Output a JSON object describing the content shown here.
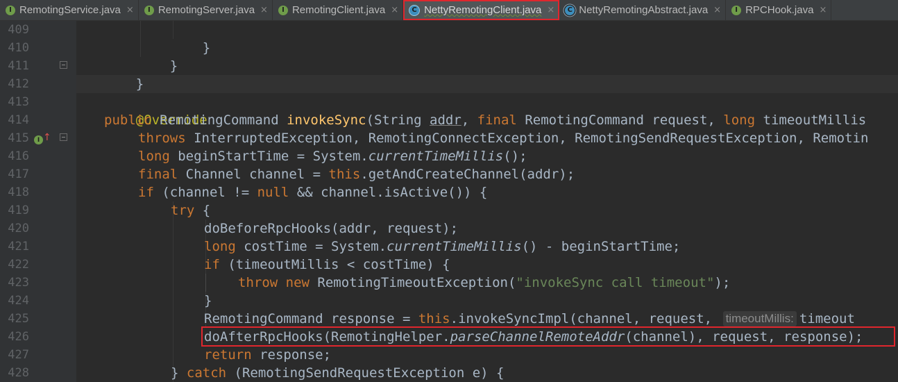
{
  "tabs": [
    {
      "label": "RemotingService.java",
      "icon": "I",
      "kind": "interface",
      "active": false
    },
    {
      "label": "RemotingServer.java",
      "icon": "I",
      "kind": "interface",
      "active": false
    },
    {
      "label": "RemotingClient.java",
      "icon": "I",
      "kind": "interface",
      "active": false
    },
    {
      "label": "NettyRemotingClient.java",
      "icon": "C",
      "kind": "class",
      "active": true
    },
    {
      "label": "NettyRemotingAbstract.java",
      "icon": "C",
      "kind": "abstract-class",
      "active": false
    },
    {
      "label": "RPCHook.java",
      "icon": "I",
      "kind": "interface",
      "active": false
    }
  ],
  "tab_close_glyph": "×",
  "gutter": {
    "line_numbers": [
      "409",
      "410",
      "411",
      "412",
      "413",
      "414",
      "415",
      "416",
      "417",
      "418",
      "419",
      "420",
      "421",
      "422",
      "423",
      "424",
      "425",
      "426",
      "427",
      "428"
    ],
    "impl_marker_icon": "implements-method-icon",
    "impl_marker_letter": "I",
    "override_arrow": "↑"
  },
  "colors": {
    "background": "#2b2b2b",
    "keyword": "#cc7832",
    "annotation": "#bbb529",
    "method_decl": "#ffc66d",
    "string": "#6a8759",
    "default_text": "#a9b7c6",
    "highlight_box": "#e0262d"
  },
  "code": {
    "l409": {
      "brace": "}"
    },
    "l410": {
      "brace": "}"
    },
    "l411": {
      "brace": "}"
    },
    "l413": {
      "annotation": "@Override"
    },
    "l414": {
      "kw_public": "public",
      "type": " RemotingCommand ",
      "method": "invokeSync",
      "params_a": "(String ",
      "addr": "addr",
      "params_b": ", ",
      "kw_final": "final",
      "params_c": " RemotingCommand request, ",
      "kw_long": "long",
      "params_d": " timeoutMillis"
    },
    "l415": {
      "kw_throws": "throws",
      "rest": " InterruptedException, RemotingConnectException, RemotingSendRequestException, Remotin"
    },
    "l416": {
      "kw_long": "long",
      "a": " beginStartTime = System.",
      "call": "currentTimeMillis",
      "b": "();"
    },
    "l417": {
      "kw_final": "final",
      "a": " Channel channel = ",
      "kw_this": "this",
      "b": ".getAndCreateChannel(addr);"
    },
    "l418": {
      "kw_if": "if",
      "a": " (channel != ",
      "kw_null": "null",
      "b": " && channel.isActive()) {"
    },
    "l419": {
      "kw_try": "try",
      "b": " {"
    },
    "l420": {
      "text": "doBeforeRpcHooks(addr, request);"
    },
    "l421": {
      "kw_long": "long",
      "a": " costTime = System.",
      "call": "currentTimeMillis",
      "b": "() - beginStartTime;"
    },
    "l422": {
      "kw_if": "if",
      "b": " (timeoutMillis < costTime) {"
    },
    "l423": {
      "kw_throw": "throw",
      "kw_new": "new",
      "a": " RemotingTimeoutException(",
      "str": "\"invokeSync call timeout\"",
      "b": ");"
    },
    "l424": {
      "brace": "}"
    },
    "l425": {
      "a": "RemotingCommand response = ",
      "kw_this": "this",
      "b": ".invokeSyncImpl(channel, request, ",
      "hint": "timeoutMillis:",
      "c": "timeout"
    },
    "l426": {
      "a": "doAfterRpcHooks(RemotingHelper.",
      "call": "parseChannelRemoteAddr",
      "b": "(channel), request, response);"
    },
    "l427": {
      "kw_return": "return",
      "b": " response;"
    },
    "l428": {
      "a": "} ",
      "kw_catch": "catch",
      "b": " (RemotingSendRequestException e) {"
    }
  }
}
